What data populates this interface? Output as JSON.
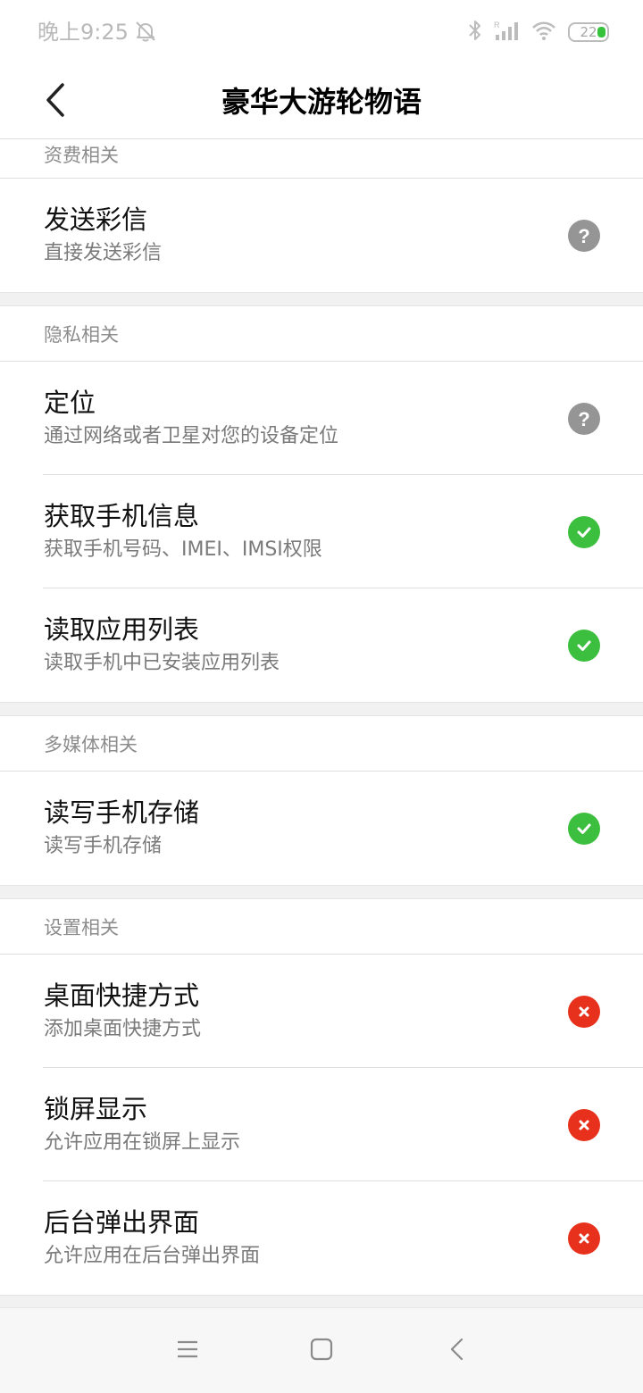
{
  "status_bar": {
    "time": "晚上9:25",
    "battery": "22",
    "icons": [
      "bell-off-icon",
      "bluetooth-icon",
      "signal-icon",
      "wifi-icon",
      "battery-icon"
    ]
  },
  "header": {
    "title": "豪华大游轮物语",
    "back_icon": "chevron-left-icon"
  },
  "sections": [
    {
      "title": "资费相关",
      "items": [
        {
          "title": "发送彩信",
          "desc": "直接发送彩信",
          "status": "unknown"
        }
      ]
    },
    {
      "title": "隐私相关",
      "items": [
        {
          "title": "定位",
          "desc": "通过网络或者卫星对您的设备定位",
          "status": "unknown"
        },
        {
          "title": "获取手机信息",
          "desc": "获取手机号码、IMEI、IMSI权限",
          "status": "granted"
        },
        {
          "title": "读取应用列表",
          "desc": "读取手机中已安装应用列表",
          "status": "granted"
        }
      ]
    },
    {
      "title": "多媒体相关",
      "items": [
        {
          "title": "读写手机存储",
          "desc": "读写手机存储",
          "status": "granted"
        }
      ]
    },
    {
      "title": "设置相关",
      "items": [
        {
          "title": "桌面快捷方式",
          "desc": "添加桌面快捷方式",
          "status": "denied"
        },
        {
          "title": "锁屏显示",
          "desc": "允许应用在锁屏上显示",
          "status": "denied"
        },
        {
          "title": "后台弹出界面",
          "desc": "允许应用在后台弹出界面",
          "status": "denied"
        }
      ]
    }
  ],
  "colors": {
    "granted": "#3cbf3f",
    "denied": "#e8311c",
    "unknown": "#959595"
  },
  "nav_bar": {
    "icons": [
      "menu-icon",
      "home-icon",
      "back-icon"
    ]
  }
}
